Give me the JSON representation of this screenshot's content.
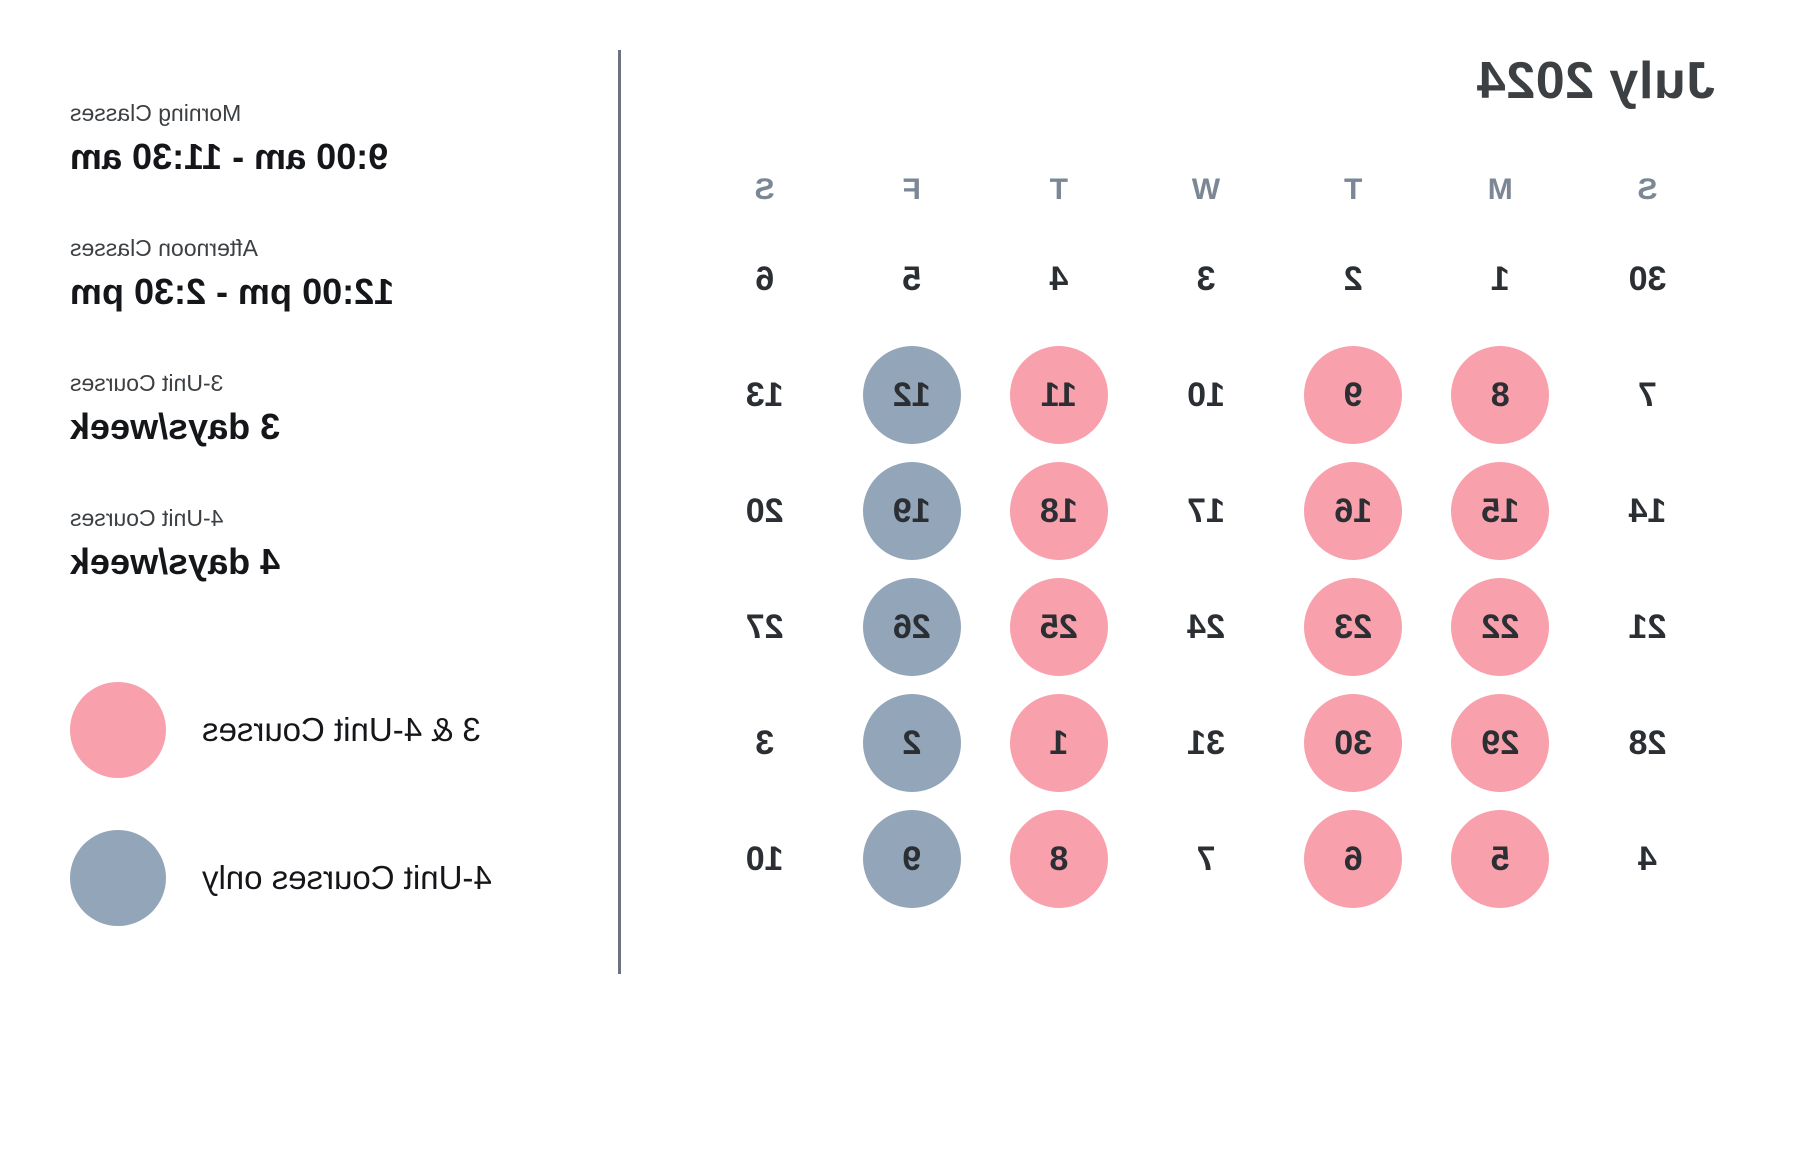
{
  "calendar": {
    "title": "July 2024",
    "weekdays": [
      "S",
      "M",
      "T",
      "W",
      "T",
      "F",
      "S"
    ],
    "weeks": [
      [
        {
          "day": "30",
          "state": "plain"
        },
        {
          "day": "1",
          "state": "plain"
        },
        {
          "day": "2",
          "state": "plain"
        },
        {
          "day": "3",
          "state": "plain"
        },
        {
          "day": "4",
          "state": "plain"
        },
        {
          "day": "5",
          "state": "plain"
        },
        {
          "day": "6",
          "state": "plain"
        }
      ],
      [
        {
          "day": "7",
          "state": "plain"
        },
        {
          "day": "8",
          "state": "pink"
        },
        {
          "day": "9",
          "state": "pink"
        },
        {
          "day": "10",
          "state": "plain"
        },
        {
          "day": "11",
          "state": "pink"
        },
        {
          "day": "12",
          "state": "blue"
        },
        {
          "day": "13",
          "state": "plain"
        }
      ],
      [
        {
          "day": "14",
          "state": "plain"
        },
        {
          "day": "15",
          "state": "pink"
        },
        {
          "day": "16",
          "state": "pink"
        },
        {
          "day": "17",
          "state": "plain"
        },
        {
          "day": "18",
          "state": "pink"
        },
        {
          "day": "19",
          "state": "blue"
        },
        {
          "day": "20",
          "state": "plain"
        }
      ],
      [
        {
          "day": "21",
          "state": "plain"
        },
        {
          "day": "22",
          "state": "pink"
        },
        {
          "day": "23",
          "state": "pink"
        },
        {
          "day": "24",
          "state": "plain"
        },
        {
          "day": "25",
          "state": "pink"
        },
        {
          "day": "26",
          "state": "blue"
        },
        {
          "day": "27",
          "state": "plain"
        }
      ],
      [
        {
          "day": "28",
          "state": "plain"
        },
        {
          "day": "29",
          "state": "pink"
        },
        {
          "day": "30",
          "state": "pink"
        },
        {
          "day": "31",
          "state": "plain"
        },
        {
          "day": "1",
          "state": "pink"
        },
        {
          "day": "2",
          "state": "blue"
        },
        {
          "day": "3",
          "state": "plain"
        }
      ],
      [
        {
          "day": "4",
          "state": "plain"
        },
        {
          "day": "5",
          "state": "pink"
        },
        {
          "day": "6",
          "state": "pink"
        },
        {
          "day": "7",
          "state": "plain"
        },
        {
          "day": "8",
          "state": "pink"
        },
        {
          "day": "9",
          "state": "blue"
        },
        {
          "day": "10",
          "state": "plain"
        }
      ]
    ]
  },
  "info": {
    "schedule": [
      {
        "label": "Morning Classes",
        "value": "9:00 am - 11:30 am"
      },
      {
        "label": "Afternoon Classes",
        "value": "12:00 pm - 2:30 pm"
      },
      {
        "label": "3-Unit Courses",
        "value": "3 days/week"
      },
      {
        "label": "4-Unit Courses",
        "value": "4 days/week"
      }
    ],
    "legend": [
      {
        "text": "3 & 4-Unit Courses",
        "color_name": "pink",
        "color": "#f8a0ac"
      },
      {
        "text": "4-Unit Courses only",
        "color_name": "blue",
        "color": "#93a5b8"
      }
    ]
  },
  "colors": {
    "pink": "#f8a0ac",
    "blue": "#93a5b8",
    "text_dark": "#141619",
    "text_muted": "#7b8794",
    "divider": "#6b7280",
    "background": "#ffffff"
  }
}
